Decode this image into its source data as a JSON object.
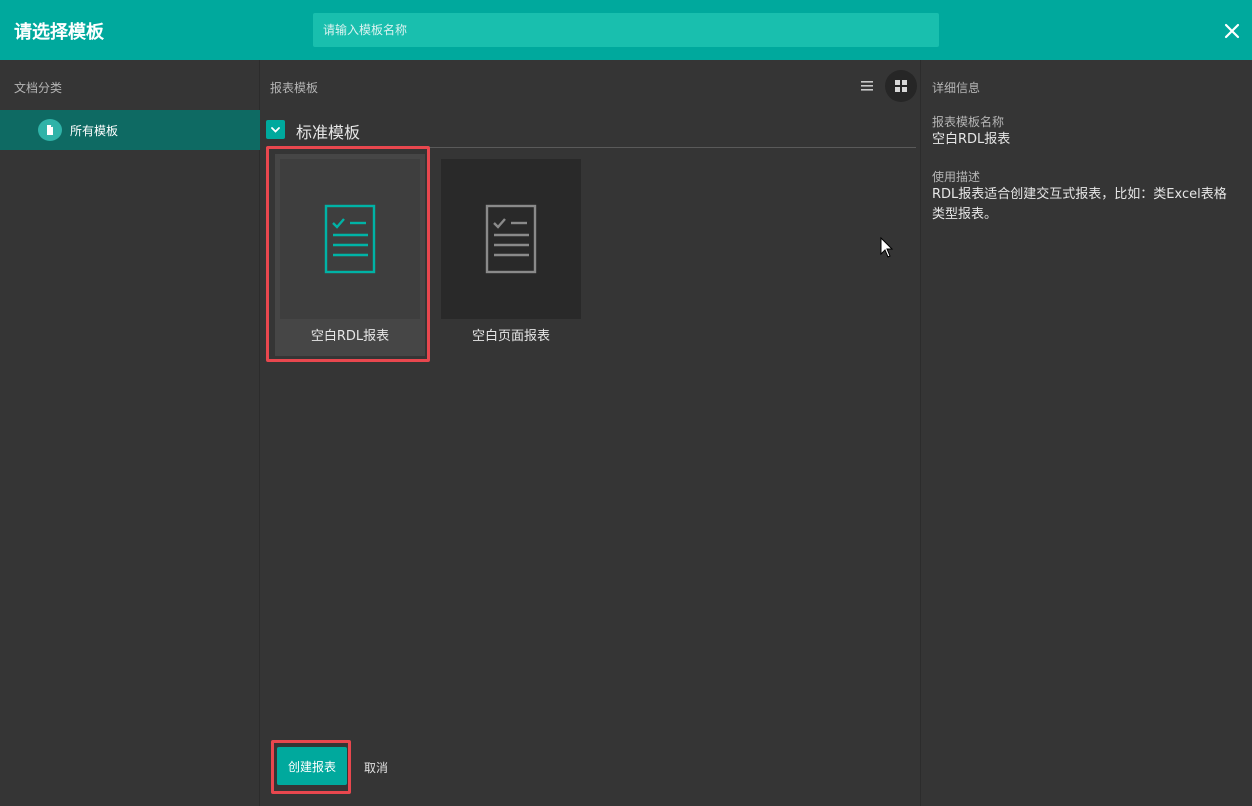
{
  "header": {
    "title": "请选择模板",
    "search_placeholder": "请输入模板名称",
    "close_icon": "close-icon"
  },
  "sidebar": {
    "title": "文档分类",
    "items": [
      {
        "label": "所有模板",
        "icon": "document-icon",
        "selected": true
      }
    ]
  },
  "main": {
    "title": "报表模板",
    "view_icons": [
      "list-view-icon",
      "grid-view-icon"
    ],
    "group": {
      "title": "标准模板",
      "templates": [
        {
          "label": "空白RDL报表",
          "icon": "report-icon",
          "selected": true
        },
        {
          "label": "空白页面报表",
          "icon": "report-icon",
          "selected": false
        }
      ]
    },
    "create_label": "创建报表",
    "cancel_label": "取消"
  },
  "detail": {
    "title": "详细信息",
    "name_label": "报表模板名称",
    "name_value": "空白RDL报表",
    "desc_label": "使用描述",
    "desc_value": "RDL报表适合创建交互式报表，比如：类Excel表格类型报表。"
  },
  "colors": {
    "accent": "#00a99d",
    "highlight": "#e8474e",
    "background": "#353535"
  }
}
